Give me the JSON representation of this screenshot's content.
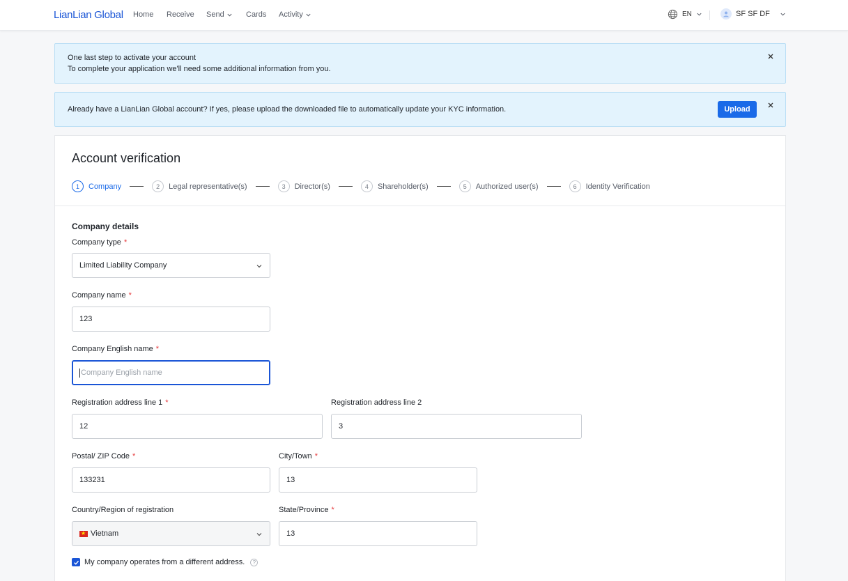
{
  "nav": {
    "logo": "LianLian Global",
    "items": [
      {
        "label": "Home",
        "dropdown": false
      },
      {
        "label": "Receive",
        "dropdown": false
      },
      {
        "label": "Send",
        "dropdown": true
      },
      {
        "label": "Cards",
        "dropdown": false
      },
      {
        "label": "Activity",
        "dropdown": true
      }
    ],
    "language": "EN",
    "user_name": "SF SF DF"
  },
  "banners": {
    "activate_title": "One last step to activate your account",
    "activate_sub": "To complete your application we'll need some additional information from you.",
    "kyc_text": "Already have a LianLian Global account? If yes, please upload the downloaded file to automatically update your KYC information.",
    "upload_label": "Upload"
  },
  "verification": {
    "title": "Account verification",
    "steps": [
      {
        "num": "1",
        "label": "Company",
        "active": true
      },
      {
        "num": "2",
        "label": "Legal representative(s)",
        "active": false
      },
      {
        "num": "3",
        "label": "Director(s)",
        "active": false
      },
      {
        "num": "4",
        "label": "Shareholder(s)",
        "active": false
      },
      {
        "num": "5",
        "label": "Authorized user(s)",
        "active": false
      },
      {
        "num": "6",
        "label": "Identity Verification",
        "active": false
      }
    ]
  },
  "form": {
    "section_title": "Company details",
    "company_type": {
      "label": "Company type",
      "required": "*",
      "value": "Limited Liability Company"
    },
    "company_name": {
      "label": "Company name",
      "required": "*",
      "value": "123"
    },
    "company_english_name": {
      "label": "Company English name",
      "required": "*",
      "placeholder": "Company English name"
    },
    "address_line1": {
      "label": "Registration address line 1",
      "required": "*",
      "value": "12"
    },
    "address_line2": {
      "label": "Registration address line 2",
      "value": "3"
    },
    "postal_code": {
      "label": "Postal/ ZIP Code",
      "required": "*",
      "value": "133231"
    },
    "city": {
      "label": "City/Town",
      "required": "*",
      "value": "13"
    },
    "country": {
      "label": "Country/Region of registration",
      "value": "Vietnam"
    },
    "state": {
      "label": "State/Province",
      "required": "*",
      "value": "13"
    },
    "different_address": {
      "label": "My company operates from a different address.",
      "checked": true,
      "help": "?"
    }
  },
  "colors": {
    "primary": "#1a6ae8",
    "banner_bg": "#e3f3fd",
    "required": "#e5383b"
  }
}
